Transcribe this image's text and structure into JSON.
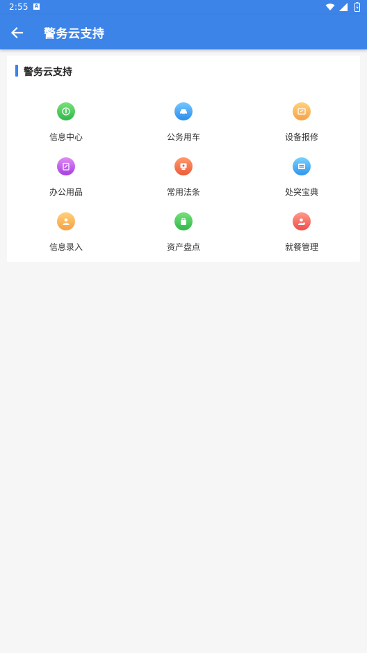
{
  "status_bar": {
    "time": "2:55",
    "notification_icon": "a-icon",
    "right_icons": [
      "wifi-icon",
      "signal-icon",
      "battery-icon"
    ]
  },
  "app_bar": {
    "back_icon": "arrow-left-icon",
    "title": "警务云支持",
    "background": "#3d84e8"
  },
  "section": {
    "title": "警务云支持",
    "accent_color": "#3d84e8",
    "items": [
      {
        "label": "信息中心",
        "icon": "info-center-icon",
        "color_top": "#7be07b",
        "color_bottom": "#2fb84a"
      },
      {
        "label": "公务用车",
        "icon": "car-icon",
        "color_top": "#76c7fb",
        "color_bottom": "#2b8def"
      },
      {
        "label": "设备报修",
        "icon": "repair-icon",
        "color_top": "#ffd27a",
        "color_bottom": "#f5a24a"
      },
      {
        "label": "办公用品",
        "icon": "office-supplies-icon",
        "color_top": "#e08bf5",
        "color_bottom": "#a43fe0"
      },
      {
        "label": "常用法条",
        "icon": "law-icon",
        "color_top": "#ff9a6e",
        "color_bottom": "#ee5a3a"
      },
      {
        "label": "处突宝典",
        "icon": "handbook-icon",
        "color_top": "#79d2fb",
        "color_bottom": "#2e95ee"
      },
      {
        "label": "信息录入",
        "icon": "user-entry-icon",
        "color_top": "#ffd17c",
        "color_bottom": "#f5a043"
      },
      {
        "label": "资产盘点",
        "icon": "asset-icon",
        "color_top": "#78e07a",
        "color_bottom": "#2fb84a"
      },
      {
        "label": "就餐管理",
        "icon": "dining-icon",
        "color_top": "#ff9a8a",
        "color_bottom": "#ee4d4a"
      }
    ]
  }
}
